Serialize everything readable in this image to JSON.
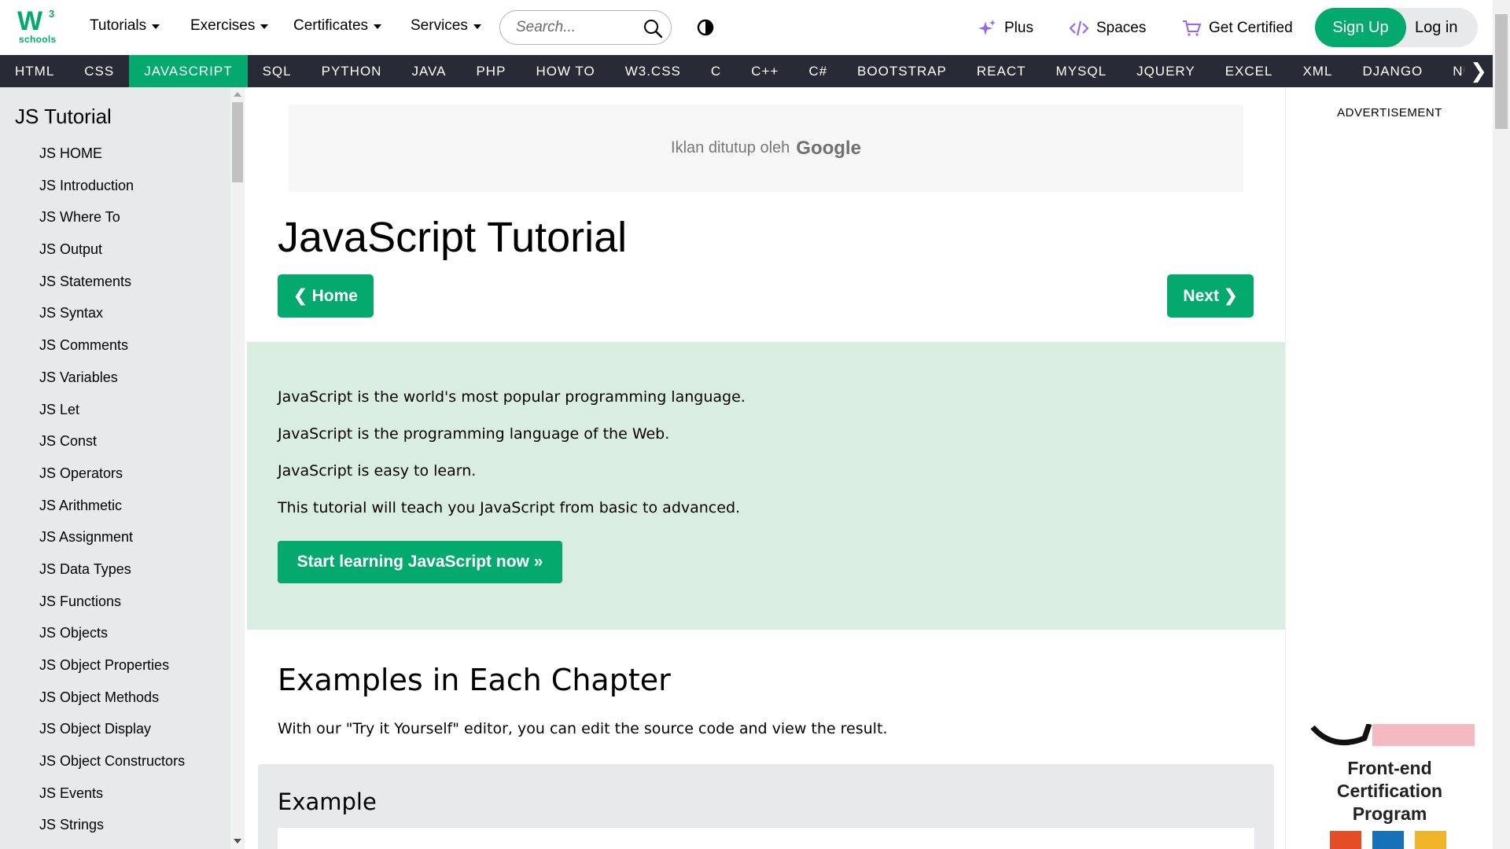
{
  "header": {
    "logo_text": "schools",
    "logo_superscript": "3",
    "nav": [
      "Tutorials",
      "Exercises",
      "Certificates",
      "Services"
    ],
    "search_placeholder": "Search...",
    "plus": "Plus",
    "spaces": "Spaces",
    "get_certified": "Get Certified",
    "sign_up": "Sign Up",
    "log_in": "Log in"
  },
  "subjects": [
    "HTML",
    "CSS",
    "JAVASCRIPT",
    "SQL",
    "PYTHON",
    "JAVA",
    "PHP",
    "HOW TO",
    "W3.CSS",
    "C",
    "C++",
    "C#",
    "BOOTSTRAP",
    "REACT",
    "MYSQL",
    "JQUERY",
    "EXCEL",
    "XML",
    "DJANGO",
    "NUMPY"
  ],
  "active_subject": "JAVASCRIPT",
  "sidebar": {
    "title": "JS Tutorial",
    "items": [
      "JS HOME",
      "JS Introduction",
      "JS Where To",
      "JS Output",
      "JS Statements",
      "JS Syntax",
      "JS Comments",
      "JS Variables",
      "JS Let",
      "JS Const",
      "JS Operators",
      "JS Arithmetic",
      "JS Assignment",
      "JS Data Types",
      "JS Functions",
      "JS Objects",
      "JS Object Properties",
      "JS Object Methods",
      "JS Object Display",
      "JS Object Constructors",
      "JS Events",
      "JS Strings"
    ]
  },
  "main": {
    "ad_text": "Iklan ditutup oleh",
    "ad_brand": "Google",
    "title": "JavaScript Tutorial",
    "home_button": "Home",
    "next_button": "Next",
    "intro": [
      "JavaScript is the world's most popular programming language.",
      "JavaScript is the programming language of the Web.",
      "JavaScript is easy to learn.",
      "This tutorial will teach you JavaScript from basic to advanced."
    ],
    "start_button": "Start learning JavaScript now »",
    "examples_heading": "Examples in Each Chapter",
    "examples_text": "With our \"Try it Yourself\" editor, you can edit the source code and view the result.",
    "example_heading": "Example"
  },
  "right": {
    "advertisement": "ADVERTISEMENT",
    "promo_line1": "Front-end",
    "promo_line2": "Certification",
    "promo_line3": "Program"
  },
  "colors": {
    "brand_green": "#04aa6d",
    "dark_bar": "#282a35",
    "sidebar_bg": "#e7e9eb",
    "intro_bg": "#d9eee1",
    "accent_purple": "#9763f6"
  }
}
